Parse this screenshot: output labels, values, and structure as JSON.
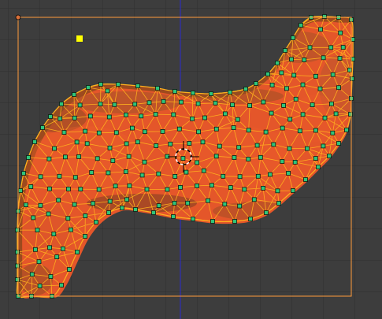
{
  "viewport": {
    "type": "uv-editor",
    "grid": true,
    "y_axis_color": "#2b2bd0",
    "background_color": "#3d3d3d",
    "grid_color": "#2f2f2f"
  },
  "image_bounds": {
    "outline_color": "#ff9a3c",
    "corner_handle_color": "#d8703a"
  },
  "mesh": {
    "fill_color": "#e4562a",
    "shadow_color": "#9d4a1e",
    "edge_color": "#ffb21e",
    "vertex_color": "#2fc47a",
    "vertex_outline_color": "#0b1a12",
    "active_vertex_color": "#ffff00",
    "vertex_count": 240
  },
  "cursor": {
    "icon": "2d-cursor-icon",
    "color_a": "#ffffff",
    "color_b": "#000000"
  }
}
